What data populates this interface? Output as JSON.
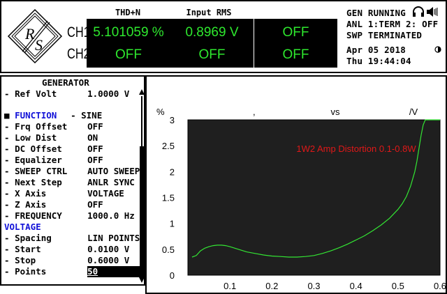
{
  "header": {
    "logo_text": "R/S",
    "ch1_label": "CH1",
    "ch2_label": "CH2",
    "meters": [
      {
        "title": "THD+N",
        "ch1": "5.101059 %",
        "ch2": "OFF"
      },
      {
        "title": "Input RMS",
        "ch1": "0.8969  V",
        "ch2": "OFF"
      },
      {
        "title": "",
        "ch1": "OFF",
        "ch2": "OFF"
      }
    ],
    "status": {
      "line1": "GEN RUNNING",
      "line2": "ANL 1:TERM 2: OFF",
      "line3": "SWP TERMINATED",
      "date": "Apr 05 2018",
      "time": "Thu 19:44:04"
    },
    "icons": {
      "headphone": "headphone-icon",
      "speaker": "speaker-icon",
      "sync": "sync-icon"
    }
  },
  "generator": {
    "title": "GENERATOR",
    "rows": [
      {
        "label": "Ref Volt",
        "value": "1.0000 V",
        "bullet": "-"
      },
      {
        "label": "FUNCTION",
        "value": "SINE",
        "bullet": "■",
        "highlight": true
      },
      {
        "label": "Frq Offset",
        "value": "OFF",
        "bullet": "-"
      },
      {
        "label": "Low Dist",
        "value": "ON",
        "bullet": "-"
      },
      {
        "label": "DC Offset",
        "value": "OFF",
        "bullet": "-"
      },
      {
        "label": "Equalizer",
        "value": "OFF",
        "bullet": "-"
      },
      {
        "label": "SWEEP CTRL",
        "value": "AUTO SWEEP",
        "bullet": "-"
      },
      {
        "label": "Next Step",
        "value": "ANLR SYNC",
        "bullet": "-"
      },
      {
        "label": "X Axis",
        "value": "VOLTAGE",
        "bullet": "-"
      },
      {
        "label": "Z Axis",
        "value": "OFF",
        "bullet": "-"
      },
      {
        "label": "FREQUENCY",
        "value": "1000.0 Hz",
        "bullet": "-"
      }
    ],
    "section": "VOLTAGE",
    "section_rows": [
      {
        "label": "Spacing",
        "value": "LIN POINTS",
        "bullet": "-"
      },
      {
        "label": "Start",
        "value": "0.0100 V",
        "bullet": "-"
      },
      {
        "label": "Stop",
        "value": "0.6000 V",
        "bullet": "-"
      },
      {
        "label": "Points",
        "value": "50",
        "bullet": "-",
        "editing": true
      }
    ]
  },
  "graph_labels": {
    "y_unit": "%",
    "comma": ",",
    "vs": "vs",
    "x_unit": "/V"
  },
  "chart_data": {
    "type": "line",
    "title": "1W2 Amp Distortion 0.1-0.8W",
    "xlabel": "",
    "ylabel": "%",
    "xlim": [
      0,
      0.6
    ],
    "ylim": [
      0,
      3
    ],
    "xticks": [
      "0.1",
      "0.2",
      "0.3",
      "0.4",
      "0.5",
      "0.6"
    ],
    "yticks": [
      "0",
      "0.5",
      "1",
      "1.5",
      "2",
      "2.5",
      "3"
    ],
    "series": [
      {
        "color": "#33e633",
        "x": [
          0.01,
          0.02,
          0.03,
          0.04,
          0.05,
          0.06,
          0.07,
          0.08,
          0.09,
          0.1,
          0.12,
          0.14,
          0.16,
          0.18,
          0.2,
          0.22,
          0.24,
          0.26,
          0.28,
          0.3,
          0.32,
          0.34,
          0.36,
          0.38,
          0.4,
          0.42,
          0.44,
          0.46,
          0.48,
          0.5,
          0.51,
          0.52,
          0.53,
          0.54,
          0.545,
          0.55,
          0.555,
          0.56,
          0.565,
          0.57,
          0.58,
          0.59,
          0.6
        ],
        "y": [
          0.35,
          0.38,
          0.47,
          0.52,
          0.55,
          0.57,
          0.58,
          0.58,
          0.57,
          0.55,
          0.5,
          0.45,
          0.42,
          0.39,
          0.37,
          0.36,
          0.35,
          0.35,
          0.36,
          0.38,
          0.42,
          0.47,
          0.53,
          0.6,
          0.68,
          0.76,
          0.86,
          0.97,
          1.1,
          1.27,
          1.38,
          1.52,
          1.72,
          2.0,
          2.2,
          2.45,
          2.7,
          2.9,
          3.0,
          3.0,
          3.0,
          3.0,
          3.0
        ]
      }
    ],
    "grid": false,
    "background": "#1f1f1f"
  }
}
